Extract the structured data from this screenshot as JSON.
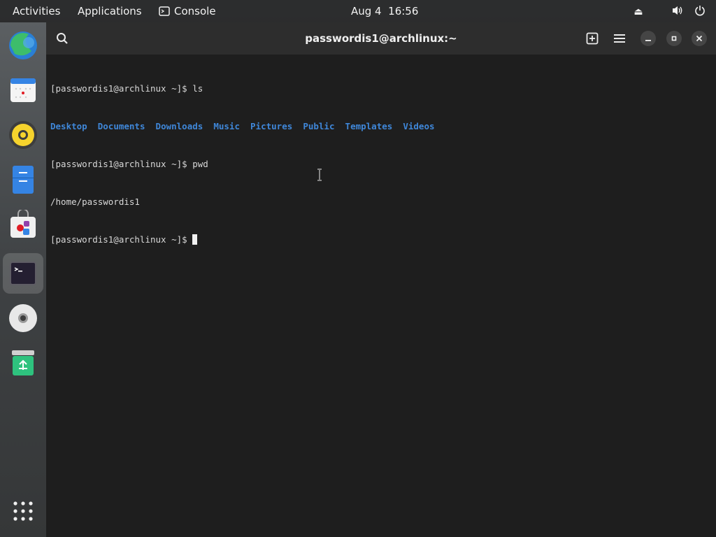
{
  "topbar": {
    "activities": "Activities",
    "applications": "Applications",
    "console": "Console",
    "date": "Aug 4",
    "time": "16:56",
    "tray_icons": [
      "eject-icon",
      "volume-icon",
      "power-icon"
    ]
  },
  "dock": {
    "items": [
      "browser-icon",
      "calendar-icon",
      "music-player-icon",
      "files-icon",
      "software-store-icon",
      "terminal-icon",
      "disc-icon",
      "trash-icon",
      "app-grid-icon"
    ],
    "active": "terminal-icon"
  },
  "window": {
    "title": "passwordis1@archlinux:~",
    "terminal": {
      "prompt": "[passwordis1@archlinux ~]$ ",
      "cmd1": "ls",
      "dirs": [
        "Desktop",
        "Documents",
        "Downloads",
        "Music",
        "Pictures",
        "Public",
        "Templates",
        "Videos"
      ],
      "cmd2": "pwd",
      "output2": "/home/passwordis1"
    }
  },
  "colors": {
    "terminal_bg": "#1e1e1e",
    "titlebar_bg": "#2d2d2d",
    "directory": "#3f87d9",
    "text": "#d8d8d8"
  }
}
